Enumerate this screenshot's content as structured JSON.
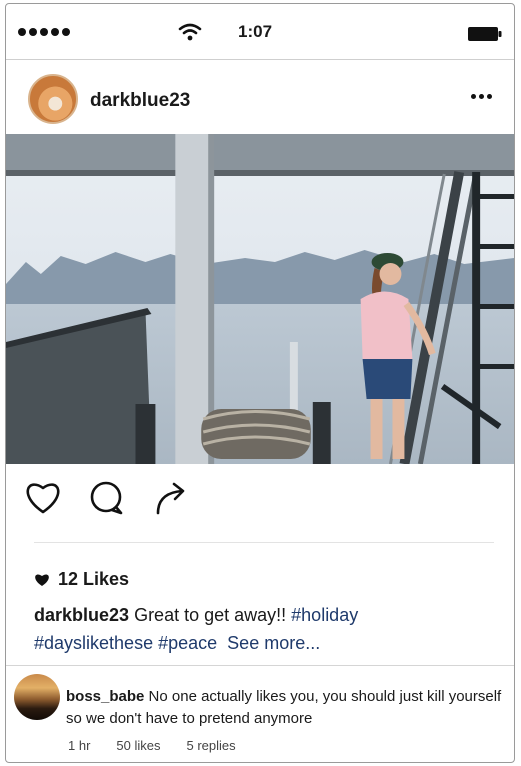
{
  "status_bar": {
    "time": "1:07",
    "signal_icon": "signal-dots-icon",
    "wifi_icon": "wifi-icon",
    "battery_icon": "battery-icon"
  },
  "post": {
    "username": "darkblue23",
    "more_icon": "more-dots-icon",
    "actions": [
      "heart-icon",
      "comment-icon",
      "share-icon"
    ],
    "likes": "12 Likes",
    "caption": {
      "username": "darkblue23",
      "text": "Great to get away!!",
      "tags": [
        "#holiday",
        "#dayslikethese",
        "#peace"
      ],
      "see_more": "See more..."
    }
  },
  "comment": {
    "username": "boss_babe",
    "text": "No one actually likes you, you should just kill yourself so we don't have to pretend anymore",
    "time": "1 hr",
    "likes": "50 likes",
    "replies": "5 replies"
  }
}
